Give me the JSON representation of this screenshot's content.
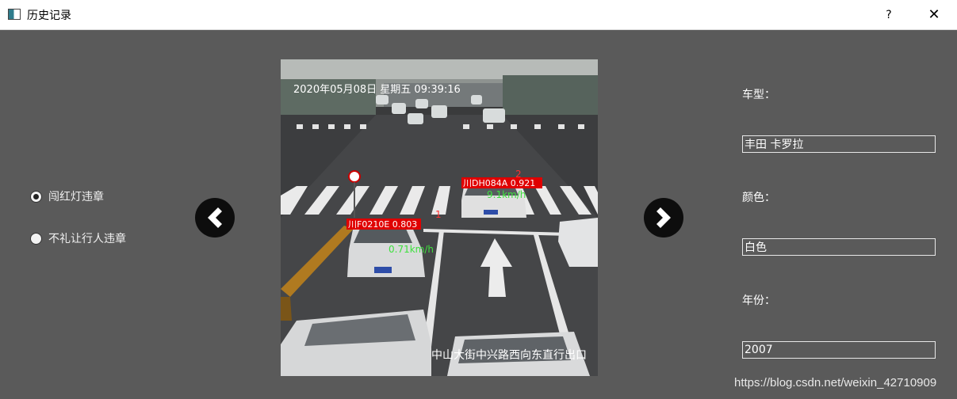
{
  "window": {
    "title": "历史记录",
    "help": "?",
    "close": "✕"
  },
  "violations": [
    {
      "label": "闯红灯违章",
      "checked": true
    },
    {
      "label": "不礼让行人违章",
      "checked": false
    }
  ],
  "nav": {
    "prev_icon": "chevron-left-icon",
    "next_icon": "chevron-right-icon"
  },
  "image": {
    "timestamp": "2020年05月08日 星期五 09:39:16",
    "location": "中山大街中兴路西向东直行出口",
    "detections": [
      {
        "id": "1",
        "plate": "川F0210E 0.803",
        "speed": "0.71km/h"
      },
      {
        "id": "2",
        "plate": "川DH084A 0.921",
        "speed": "9.1km/h"
      }
    ]
  },
  "details": {
    "model_label": "车型：",
    "model_value": "丰田 卡罗拉",
    "color_label": "颜色：",
    "color_value": "白色",
    "year_label": "年份：",
    "year_value": "2007"
  },
  "watermark": "https://blog.csdn.net/weixin_42710909"
}
